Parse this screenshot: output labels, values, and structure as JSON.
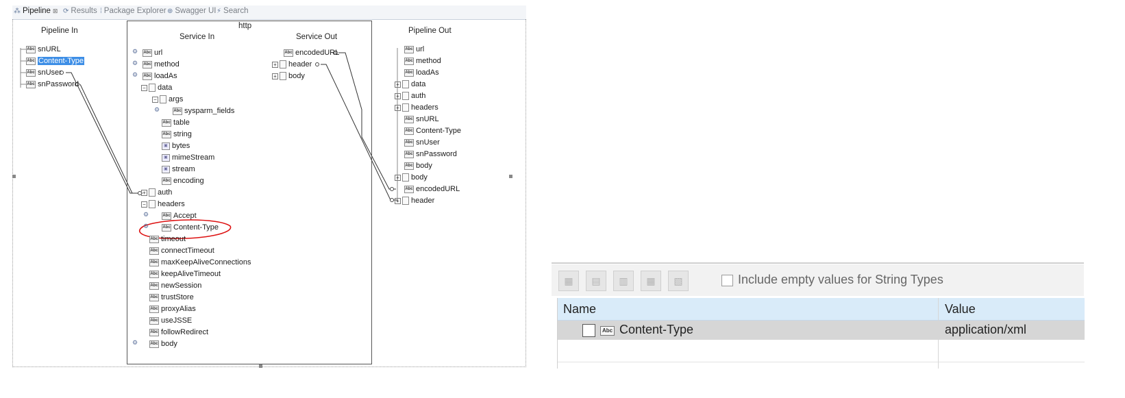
{
  "tabs": [
    {
      "label": "Pipeline",
      "close": "⊠",
      "icon": "pipeline-icon"
    },
    {
      "label": "Results",
      "icon": "results-icon"
    },
    {
      "label": "Package Explorer",
      "icon": "package-explorer-icon"
    },
    {
      "label": "Swagger UI",
      "icon": "swagger-icon"
    },
    {
      "label": "Search",
      "icon": "search-icon"
    }
  ],
  "pipeline_in": {
    "title": "Pipeline In",
    "items": [
      "snURL",
      "Content-Type",
      "snUser",
      "snPassword"
    ]
  },
  "service": {
    "name": "http",
    "in_title": "Service In",
    "out_title": "Service Out",
    "in_items": [
      "url",
      "method",
      "loadAs",
      "data",
      "args",
      "sysparm_fields",
      "table",
      "string",
      "bytes",
      "mimeStream",
      "stream",
      "encoding",
      "auth",
      "headers",
      "Accept",
      "Content-Type",
      "timeout",
      "connectTimeout",
      "maxKeepAliveConnections",
      "keepAliveTimeout",
      "newSession",
      "trustStore",
      "proxyAlias",
      "useJSSE",
      "followRedirect",
      "body"
    ],
    "out_items": [
      "encodedURL",
      "header",
      "body"
    ]
  },
  "pipeline_out": {
    "title": "Pipeline Out",
    "items": [
      "url",
      "method",
      "loadAs",
      "data",
      "auth",
      "headers",
      "snURL",
      "Content-Type",
      "snUser",
      "snPassword",
      "body",
      "body",
      "encodedURL",
      "header"
    ]
  },
  "properties": {
    "include_empty_label": "Include empty values for String Types",
    "columns": [
      "Name",
      "Value"
    ],
    "rows": [
      {
        "name": "Content-Type",
        "value": "application/xml",
        "type_icon": "Abc"
      }
    ]
  }
}
